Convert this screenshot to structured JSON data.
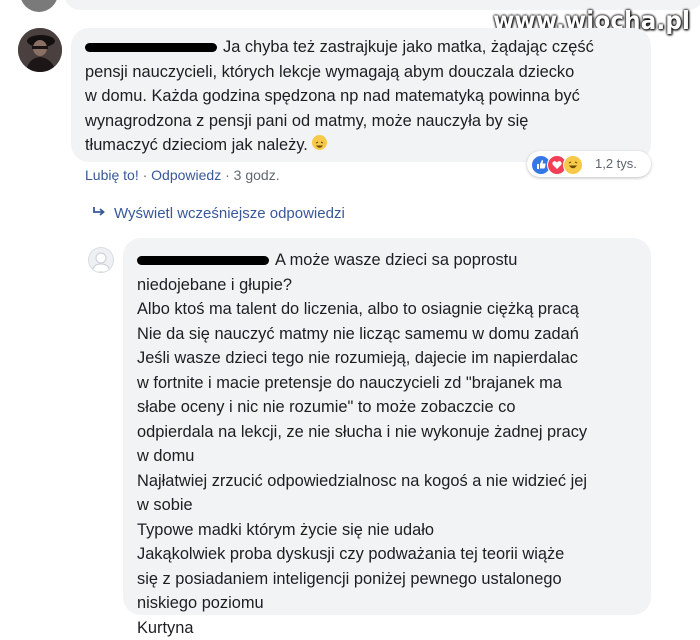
{
  "watermark": "www.wiocha.pl",
  "comment1": {
    "lines": [
      "Ja chyba też zastrajkuje jako matka, żądając część",
      "pensji nauczycieli, których lekcje wymagają abym douczala dziecko",
      "w domu. Każda godzina spędzona np nad matematyką powinna być",
      "wynagrodzona z pensji pani od matmy, może nauczyła by się",
      "tłumaczyć dzieciom jak należy."
    ],
    "actions": {
      "like": "Lubię to!",
      "reply": "Odpowiedz",
      "time": "3 godz."
    },
    "reactions": {
      "count": "1,2 tys.",
      "icons": [
        "like-icon",
        "love-icon",
        "haha-icon"
      ]
    }
  },
  "view_earlier_replies": "Wyświetl wcześniejsze odpowiedzi",
  "comment2": {
    "lines": [
      "A może wasze dzieci sa poprostu",
      "niedojebane i głupie?",
      "Albo ktoś ma talent do liczenia, albo to osiagnie ciężką pracą",
      "Nie da się nauczyć matmy nie licząc samemu w domu zadań",
      "Jeśli wasze dzieci tego nie rozumieją, dajecie im napierdalac",
      "w fortnite i macie pretensje do nauczycieli zd \"brajanek ma",
      "słabe oceny i nic nie rozumie\" to może zobaczcie co",
      "odpierdala na lekcji, ze nie słucha i nie wykonuje żadnej pracy",
      "w domu",
      "Najłatwiej zrzucić odpowiedzialnosc na kogoś a nie widzieć jej",
      "w sobie",
      "Typowe madki którym życie się nie udało",
      "Jakąkolwiek proba dyskusji czy podważania tej teorii wiąże",
      "się z posiadaniem inteligencji poniżej pewnego ustalonego",
      "niskiego poziomu",
      "Kurtyna"
    ]
  },
  "colors": {
    "bubble": "#f2f3f5",
    "link": "#385898",
    "meta": "#606770",
    "text": "#1c1e21"
  }
}
